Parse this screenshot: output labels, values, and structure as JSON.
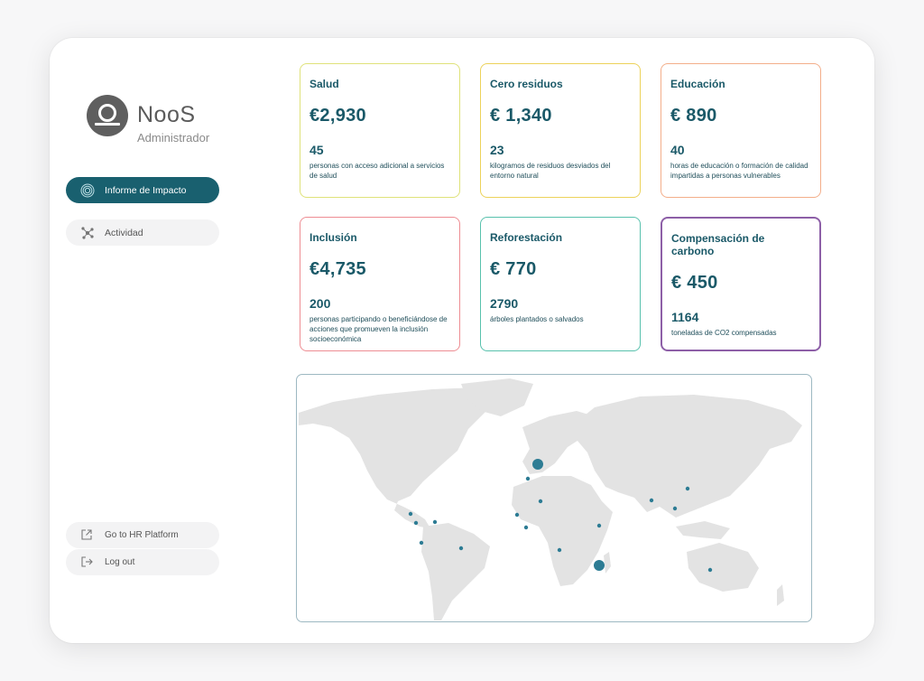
{
  "brand": {
    "name": "NooS",
    "role": "Administrador"
  },
  "nav": {
    "items": [
      {
        "label": "Informe de Impacto",
        "icon": "spiral-icon",
        "active": true
      },
      {
        "label": "Actividad",
        "icon": "network-icon",
        "active": false
      }
    ],
    "footer": [
      {
        "label": "Go to HR Platform",
        "icon": "external-link-icon"
      },
      {
        "label": "Log out",
        "icon": "logout-icon"
      }
    ]
  },
  "cards": {
    "salud": {
      "title": "Salud",
      "amount": "€2,930",
      "count": "45",
      "desc": "personas con acceso adicional a servicios de salud",
      "color": "#dfe27a"
    },
    "cero": {
      "title": "Cero residuos",
      "amount": "€ 1,340",
      "count": "23",
      "desc": "kilogramos de residuos desviados del entorno natural",
      "color": "#ecd25a"
    },
    "edu": {
      "title": "Educación",
      "amount": "€ 890",
      "count": "40",
      "desc": "horas de educación o formación de calidad impartidas a personas vulnerables",
      "color": "#f3ae8a"
    },
    "incl": {
      "title": "Inclusión",
      "amount": "€4,735",
      "count": "200",
      "desc": "personas participando o beneficiándose de acciones que promueven la inclusión socioeconómica",
      "color": "#ee8d93"
    },
    "refo": {
      "title": "Reforestación",
      "amount": "€ 770",
      "count": "2790",
      "desc": "árboles plantados o salvados",
      "color": "#58c1ad"
    },
    "carb": {
      "title": "Compensación de carbono",
      "amount": "€ 450",
      "count": "1164",
      "desc": "toneladas de CO2 compensadas",
      "color": "#8d5fa7"
    }
  },
  "map": {
    "land_color": "#e3e3e3",
    "marker_color": "#2d7c94"
  }
}
